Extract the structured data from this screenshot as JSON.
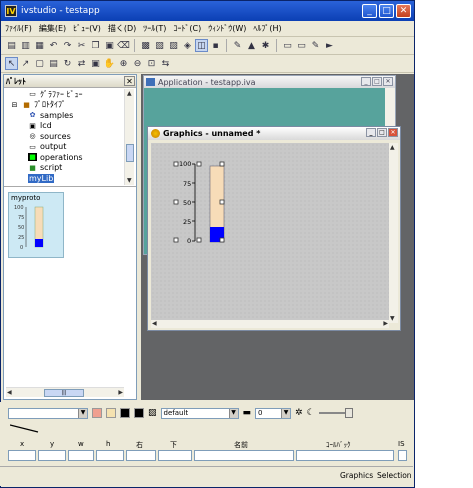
{
  "window": {
    "title": "ivstudio - testapp",
    "app_icon": "IV"
  },
  "menu": [
    "ﾌｧｲﾙ(F)",
    "編集(E)",
    "ﾋﾞｭｰ(V)",
    "描く(D)",
    "ﾂｰﾙ(T)",
    "ｺｰﾄﾞ(C)",
    "ｳｨﾝﾄﾞｳ(W)",
    "ﾍﾙﾌﾟ(H)"
  ],
  "palette": {
    "title": "ﾊﾟﾚｯﾄ",
    "tree": [
      {
        "label": "ｸﾞﾗﾌｧｰ ﾋﾞｭｰ",
        "indent": 2,
        "icon": "graph-view-icon"
      },
      {
        "label": "ﾌﾟﾛﾄﾀｲﾌﾟ",
        "indent": 0,
        "icon": "prototype-folder-icon"
      },
      {
        "label": "samples",
        "indent": 2,
        "icon": "samples-icon"
      },
      {
        "label": "lcd",
        "indent": 2,
        "icon": "lcd-icon"
      },
      {
        "label": "sources",
        "indent": 2,
        "icon": "sources-icon"
      },
      {
        "label": "output",
        "indent": 2,
        "icon": "output-icon"
      },
      {
        "label": "operations",
        "indent": 2,
        "icon": "operations-icon"
      },
      {
        "label": "script",
        "indent": 2,
        "icon": "script-icon"
      },
      {
        "label": "myLib",
        "indent": 2,
        "icon": "none",
        "selected": true
      }
    ],
    "prototype_name": "myproto",
    "prototype_ticks": [
      "100",
      "75",
      "50",
      "25",
      "0"
    ],
    "prototype_level": 0.2
  },
  "app_window": {
    "title": "Application - testapp.iva"
  },
  "graphics_window": {
    "title": "Graphics - unnamed *",
    "gauge": {
      "ticks": [
        "100",
        "75",
        "50",
        "25",
        "0"
      ],
      "value": 20,
      "max": 100
    }
  },
  "props": {
    "line_style": "default",
    "line_width": "0",
    "field_labels": [
      "x",
      "y",
      "w",
      "h",
      "右",
      "下",
      "名前",
      "ｺｰﾙﾊﾞｯｸ",
      "IS"
    ]
  },
  "status": {
    "left": "Graphics",
    "right": "Selection"
  },
  "colors": {
    "accent": "#0b3fb4",
    "workspace": "#636466",
    "app_bg": "#57a39c",
    "gauge_fill": "#0000ff",
    "gauge_bg": "#f7dcb8"
  }
}
